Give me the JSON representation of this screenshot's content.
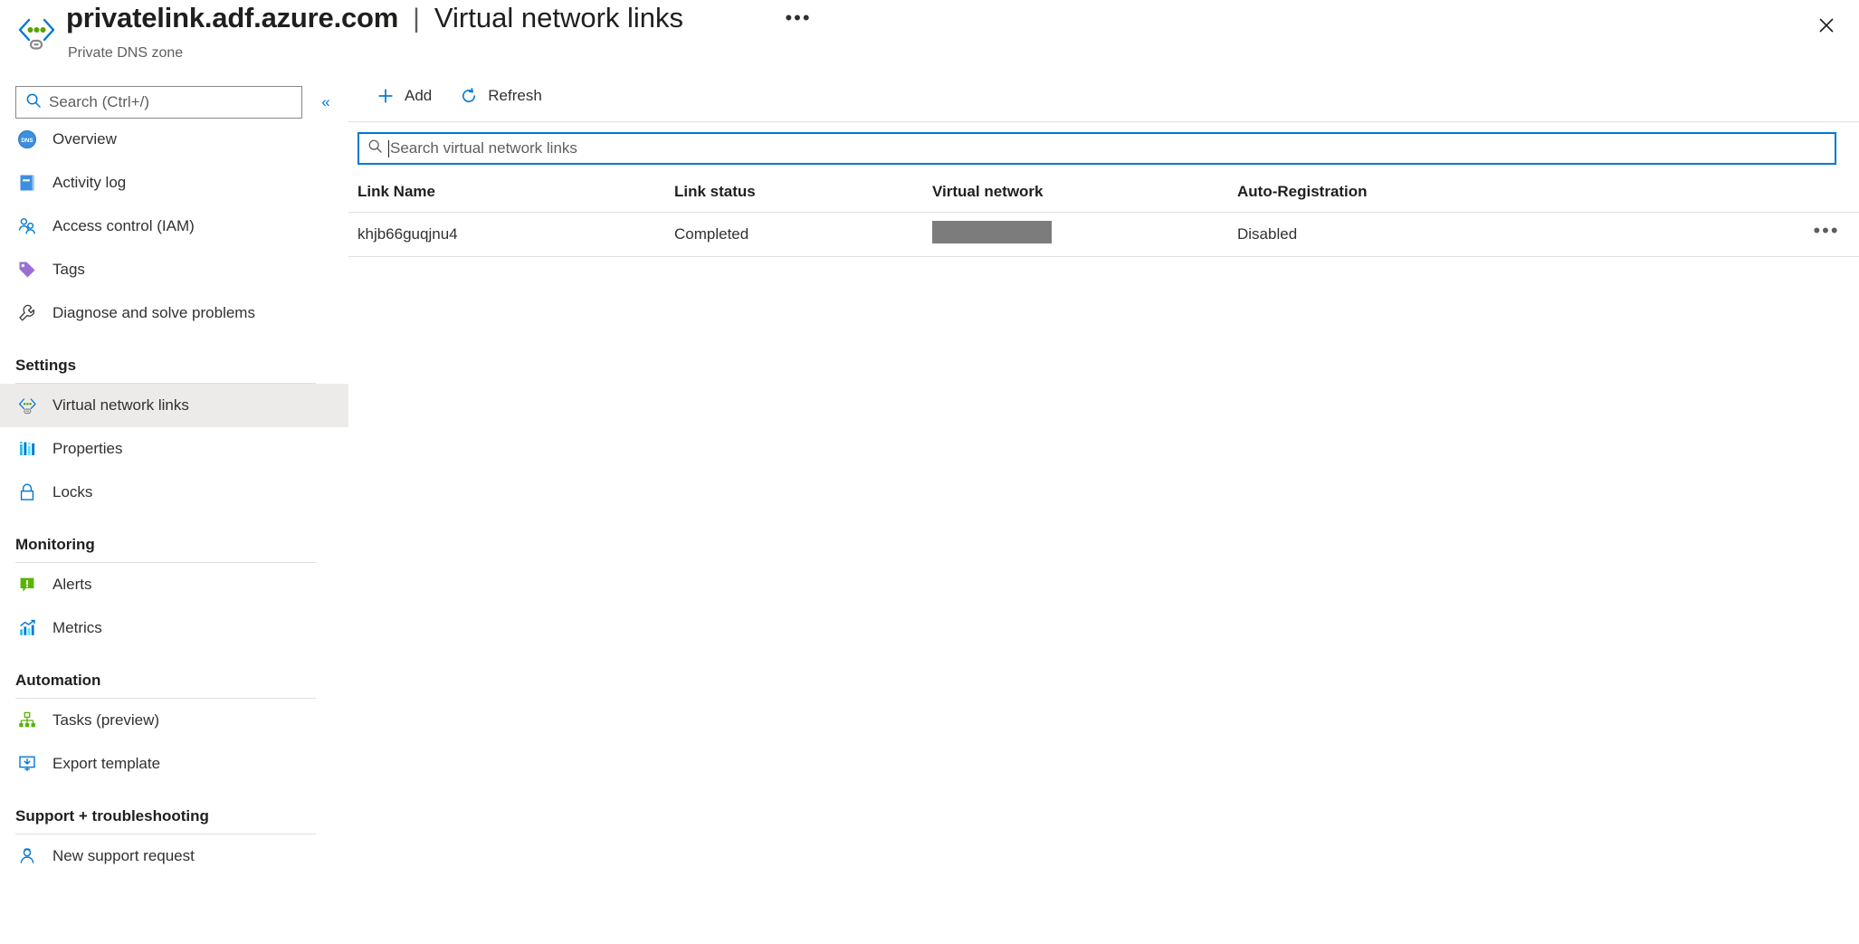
{
  "header": {
    "resource_name": "privatelink.adf.azure.com",
    "separator": "|",
    "page_name": "Virtual network links",
    "subtitle": "Private DNS zone",
    "more_label": "•••",
    "close_label": "✕",
    "zone_icon": "private-dns-zone-icon"
  },
  "sidebar": {
    "search": {
      "placeholder": "Search (Ctrl+/)",
      "value": "",
      "icon": "search-icon"
    },
    "collapse_label": "«",
    "items": [
      {
        "label": "Overview",
        "icon": "dns-circle-icon",
        "selected": false
      },
      {
        "label": "Activity log",
        "icon": "activity-log-icon",
        "selected": false
      },
      {
        "label": "Access control (IAM)",
        "icon": "people-icon",
        "selected": false
      },
      {
        "label": "Tags",
        "icon": "tag-icon",
        "selected": false
      },
      {
        "label": "Diagnose and solve problems",
        "icon": "wrench-icon",
        "selected": false
      }
    ],
    "sections": [
      {
        "title": "Settings",
        "items": [
          {
            "label": "Virtual network links",
            "icon": "vnet-link-icon",
            "selected": true
          },
          {
            "label": "Properties",
            "icon": "properties-icon",
            "selected": false
          },
          {
            "label": "Locks",
            "icon": "lock-icon",
            "selected": false
          }
        ]
      },
      {
        "title": "Monitoring",
        "items": [
          {
            "label": "Alerts",
            "icon": "alert-icon",
            "selected": false
          },
          {
            "label": "Metrics",
            "icon": "metrics-icon",
            "selected": false
          }
        ]
      },
      {
        "title": "Automation",
        "items": [
          {
            "label": "Tasks (preview)",
            "icon": "tasks-icon",
            "selected": false
          },
          {
            "label": "Export template",
            "icon": "export-template-icon",
            "selected": false
          }
        ]
      },
      {
        "title": "Support + troubleshooting",
        "items": [
          {
            "label": "New support request",
            "icon": "support-person-icon",
            "selected": false
          }
        ]
      }
    ]
  },
  "main": {
    "toolbar": {
      "add_label": "Add",
      "add_icon": "plus-icon",
      "refresh_label": "Refresh",
      "refresh_icon": "refresh-icon"
    },
    "filter": {
      "placeholder": "Search virtual network links",
      "value": "",
      "icon": "search-icon",
      "focused": true
    },
    "table": {
      "columns": [
        "Link Name",
        "Link status",
        "Virtual network",
        "Auto-Registration"
      ],
      "rows": [
        {
          "link_name": "khjb66guqjnu4",
          "link_status": "Completed",
          "virtual_network": "",
          "virtual_network_redacted": true,
          "auto_registration": "Disabled",
          "actions_label": "•••"
        }
      ]
    }
  },
  "colors": {
    "accent": "#0078d4",
    "selected_row_bg": "#edebe9",
    "divider": "#e1dfdd",
    "redaction": "#7c7c7c",
    "text_primary": "#201f1e",
    "text_secondary": "#605e5c"
  }
}
